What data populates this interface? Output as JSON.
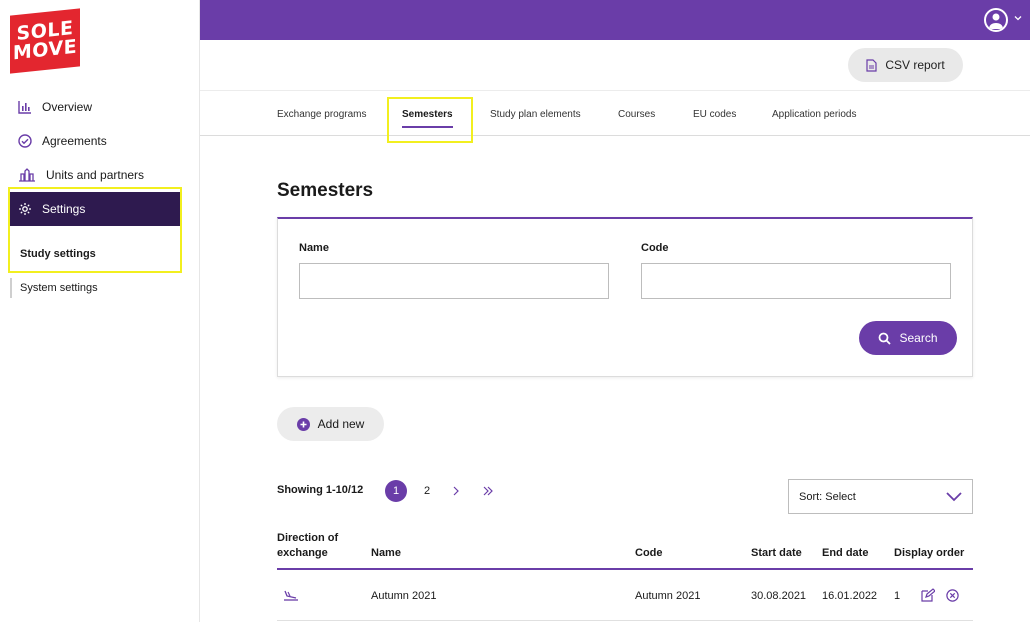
{
  "brand": {
    "line1": "SOLE",
    "line2": "MOVE",
    "color": "#e3262f"
  },
  "colors": {
    "accent": "#6a3da8",
    "nav_active": "#2e1a4f",
    "highlight": "#f2ef1f"
  },
  "sidebar": {
    "items": [
      {
        "label": "Overview",
        "icon": "bar-chart-icon"
      },
      {
        "label": "Agreements",
        "icon": "check-circle-icon"
      },
      {
        "label": "Units and partners",
        "icon": "building-icon"
      },
      {
        "label": "Settings",
        "icon": "gear-icon",
        "active": true
      }
    ],
    "subitems": [
      {
        "label": "Study settings",
        "active": true
      },
      {
        "label": "System settings"
      }
    ]
  },
  "header": {
    "csv_label": "CSV report"
  },
  "tabs": [
    {
      "label": "Exchange programs"
    },
    {
      "label": "Semesters",
      "active": true
    },
    {
      "label": "Study plan elements"
    },
    {
      "label": "Courses"
    },
    {
      "label": "EU codes"
    },
    {
      "label": "Application periods"
    }
  ],
  "main": {
    "title": "Semesters",
    "search": {
      "name_label": "Name",
      "name_value": "",
      "code_label": "Code",
      "code_value": "",
      "button": "Search"
    },
    "add_label": "Add new",
    "showing": "Showing 1-10/12",
    "pages": [
      "1",
      "2"
    ],
    "current_page": "1",
    "sort_label": "Sort: Select"
  },
  "table": {
    "headers": {
      "direction_line1": "Direction of",
      "direction_line2": "exchange",
      "name": "Name",
      "code": "Code",
      "start": "Start date",
      "end": "End date",
      "order": "Display order"
    },
    "rows": [
      {
        "direction_icon": "plane-landing-icon",
        "name": "Autumn 2021",
        "code": "Autumn 2021",
        "start": "30.08.2021",
        "end": "16.01.2022",
        "order": "1"
      }
    ]
  }
}
